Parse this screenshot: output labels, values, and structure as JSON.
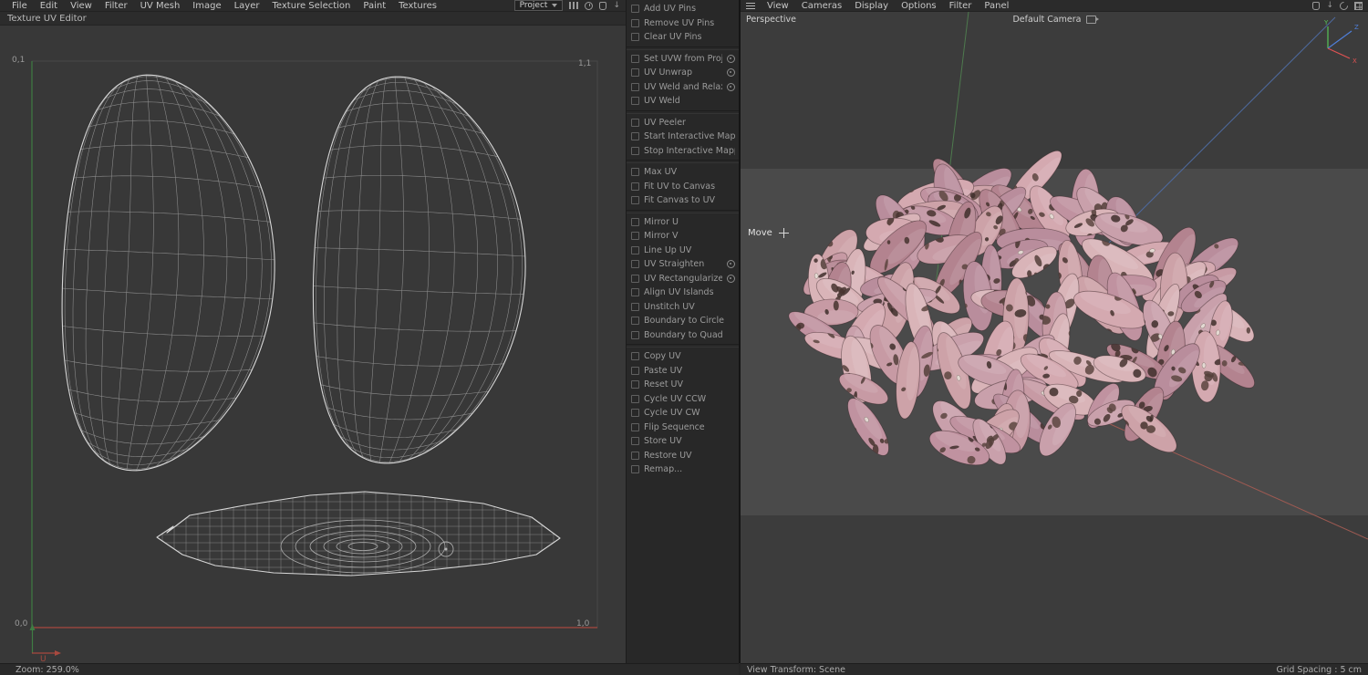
{
  "left_menubar": {
    "items": [
      "File",
      "Edit",
      "View",
      "Filter",
      "UV Mesh",
      "Image",
      "Layer",
      "Texture Selection",
      "Paint",
      "Textures"
    ],
    "project_dropdown": "Project"
  },
  "left_panel": {
    "title": "Texture UV Editor",
    "corners": {
      "tl": "0,1",
      "tr": "1,1",
      "bl": "0,0",
      "br": "1,0"
    },
    "axis_u": "U",
    "status_zoom": "Zoom: 259.0%"
  },
  "tool_menu": {
    "groups": [
      {
        "items": [
          {
            "label": "Add UV Pins"
          },
          {
            "label": "Remove UV Pins"
          },
          {
            "label": "Clear UV Pins"
          }
        ]
      },
      {
        "items": [
          {
            "label": "Set UVW from Projection",
            "gear": true
          },
          {
            "label": "UV Unwrap",
            "gear": true
          },
          {
            "label": "UV Weld and Relax",
            "gear": true
          },
          {
            "label": "UV Weld"
          }
        ]
      },
      {
        "items": [
          {
            "label": "UV Peeler"
          },
          {
            "label": "Start Interactive Mapping"
          },
          {
            "label": "Stop Interactive Mapping"
          }
        ]
      },
      {
        "items": [
          {
            "label": "Max UV"
          },
          {
            "label": "Fit UV to Canvas"
          },
          {
            "label": "Fit Canvas to UV"
          }
        ]
      },
      {
        "items": [
          {
            "label": "Mirror U"
          },
          {
            "label": "Mirror V"
          },
          {
            "label": "Line Up UV"
          },
          {
            "label": "UV Straighten",
            "gear": true
          },
          {
            "label": "UV Rectangularize",
            "gear": true
          },
          {
            "label": "Align UV Islands"
          },
          {
            "label": "Unstitch UV"
          },
          {
            "label": "Boundary to Circle"
          },
          {
            "label": "Boundary to Quad"
          }
        ]
      },
      {
        "items": [
          {
            "label": "Copy UV"
          },
          {
            "label": "Paste UV"
          },
          {
            "label": "Reset UV"
          },
          {
            "label": "Cycle UV CCW"
          },
          {
            "label": "Cycle UV CW"
          },
          {
            "label": "Flip Sequence"
          },
          {
            "label": "Store UV"
          },
          {
            "label": "Restore UV"
          },
          {
            "label": "Remap..."
          }
        ]
      }
    ]
  },
  "viewport": {
    "menu": [
      "View",
      "Cameras",
      "Display",
      "Options",
      "Filter",
      "Panel"
    ],
    "perspective_label": "Perspective",
    "camera_label": "Default Camera",
    "tool_label": "Move",
    "status_left": "View Transform: Scene",
    "status_right": "Grid Spacing : 5 cm",
    "axis_labels": {
      "x": "X",
      "y": "Y",
      "z": "Z"
    }
  },
  "colors": {
    "uv_outline": "#d6d6d6",
    "uv_grid": "#9a9a9a",
    "uv_axis_u": "#a8493f",
    "uv_axis_v": "#3f7d43",
    "axis_x": "#9e5a52",
    "axis_y": "#4e7a4e",
    "axis_z": "#4e6a9e",
    "gizmo_x": "#e05252",
    "gizmo_y": "#57c457",
    "gizmo_z": "#4f7fd9",
    "bean_palette": [
      "#d4a9b0",
      "#c79aa4",
      "#b98d9c",
      "#cda2a8",
      "#c092a0",
      "#d9b4b8",
      "#b3838f",
      "#c9a0ab"
    ],
    "bean_spots": [
      "#53403a",
      "#47342f",
      "#5c4540",
      "#3f2f2c"
    ],
    "bean_hilum": "#e6ded6"
  }
}
